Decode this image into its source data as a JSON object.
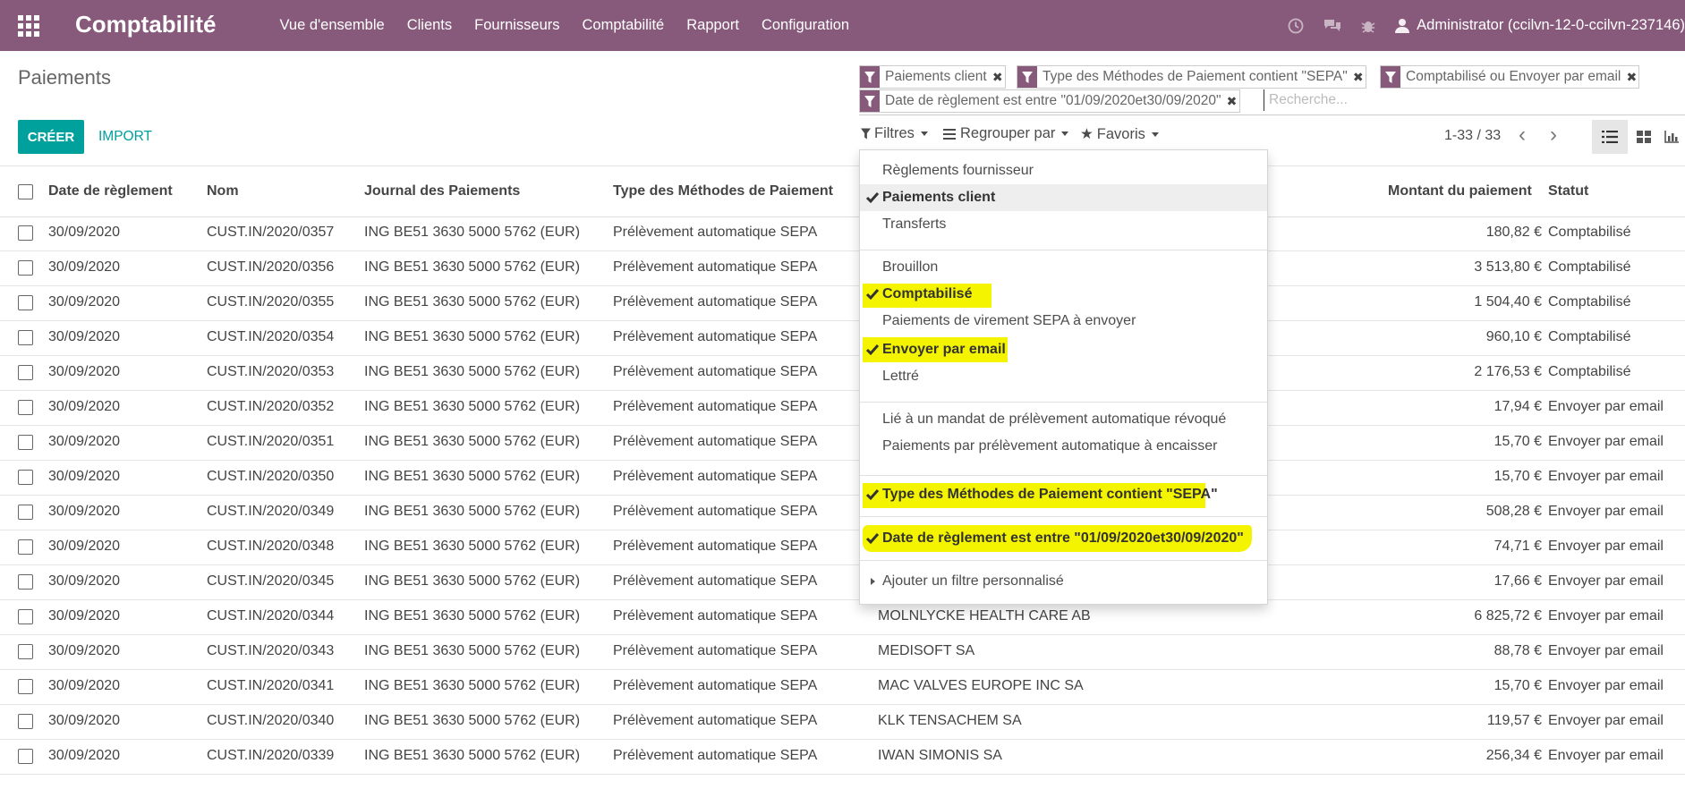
{
  "navbar": {
    "app_title": "Comptabilité",
    "menu": [
      "Vue d'ensemble",
      "Clients",
      "Fournisseurs",
      "Comptabilité",
      "Rapport",
      "Configuration"
    ],
    "user": "Administrator (ccilvn-12-0-ccilvn-237146)",
    "icons": [
      "apps-icon",
      "clock-icon",
      "chat-icon",
      "bug-icon",
      "user-icon"
    ],
    "color": "#875a7b"
  },
  "page": {
    "title": "Paiements",
    "create_label": "CRÉER",
    "import_label": "IMPORT",
    "accent": "#00a09d"
  },
  "search": {
    "facets": [
      "Paiements client",
      "Type des Méthodes de Paiement contient \"SEPA\"",
      "Comptabilisé ou Envoyer par email",
      "Date de règlement est entre \"01/09/2020et30/09/2020\""
    ],
    "placeholder": "Recherche...",
    "filters_label": "Filtres",
    "groupby_label": "Regrouper par",
    "favorites_label": "Favoris"
  },
  "pager": {
    "value": "1-33 / 33"
  },
  "filters_menu": {
    "items": [
      {
        "label": "Règlements fournisseur",
        "checked": false
      },
      {
        "label": "Paiements client",
        "checked": true
      },
      {
        "label": "Transferts",
        "checked": false
      },
      {
        "label": "Brouillon",
        "checked": false
      },
      {
        "label": "Comptabilisé",
        "checked": true
      },
      {
        "label": "Paiements de virement SEPA à envoyer",
        "checked": false
      },
      {
        "label": "Envoyer par email",
        "checked": true
      },
      {
        "label": "Lettré",
        "checked": false
      },
      {
        "label": "Lié à un mandat de prélèvement automatique révoqué",
        "checked": false
      },
      {
        "label": "Paiements par prélèvement automatique à encaisser",
        "checked": false
      },
      {
        "label": "Type des Méthodes de Paiement contient \"SEPA\"",
        "checked": true
      },
      {
        "label": "Date de règlement est entre \"01/09/2020et30/09/2020\"",
        "checked": true
      },
      {
        "label": "Ajouter un filtre personnalisé",
        "checked": false
      }
    ],
    "highlight_color": "#f4f400"
  },
  "table": {
    "columns": [
      "Date de règlement",
      "Nom",
      "Journal des Paiements",
      "Type des Méthodes de Paiement",
      "Montant du paiement",
      "Statut"
    ],
    "rows": [
      {
        "date": "30/09/2020",
        "name": "CUST.IN/2020/0357",
        "journal": "ING BE51 3630 5000 5762 (EUR)",
        "method": "Prélèvement automatique SEPA",
        "partner": "",
        "amount": "180,82 €",
        "status": "Comptabilisé"
      },
      {
        "date": "30/09/2020",
        "name": "CUST.IN/2020/0356",
        "journal": "ING BE51 3630 5000 5762 (EUR)",
        "method": "Prélèvement automatique SEPA",
        "partner": "",
        "amount": "3 513,80 €",
        "status": "Comptabilisé"
      },
      {
        "date": "30/09/2020",
        "name": "CUST.IN/2020/0355",
        "journal": "ING BE51 3630 5000 5762 (EUR)",
        "method": "Prélèvement automatique SEPA",
        "partner": "",
        "amount": "1 504,40 €",
        "status": "Comptabilisé"
      },
      {
        "date": "30/09/2020",
        "name": "CUST.IN/2020/0354",
        "journal": "ING BE51 3630 5000 5762 (EUR)",
        "method": "Prélèvement automatique SEPA",
        "partner": "",
        "amount": "960,10 €",
        "status": "Comptabilisé"
      },
      {
        "date": "30/09/2020",
        "name": "CUST.IN/2020/0353",
        "journal": "ING BE51 3630 5000 5762 (EUR)",
        "method": "Prélèvement automatique SEPA",
        "partner": "",
        "amount": "2 176,53 €",
        "status": "Comptabilisé"
      },
      {
        "date": "30/09/2020",
        "name": "CUST.IN/2020/0352",
        "journal": "ING BE51 3630 5000 5762 (EUR)",
        "method": "Prélèvement automatique SEPA",
        "partner": "",
        "amount": "17,94 €",
        "status": "Envoyer par email"
      },
      {
        "date": "30/09/2020",
        "name": "CUST.IN/2020/0351",
        "journal": "ING BE51 3630 5000 5762 (EUR)",
        "method": "Prélèvement automatique SEPA",
        "partner": "",
        "amount": "15,70 €",
        "status": "Envoyer par email"
      },
      {
        "date": "30/09/2020",
        "name": "CUST.IN/2020/0350",
        "journal": "ING BE51 3630 5000 5762 (EUR)",
        "method": "Prélèvement automatique SEPA",
        "partner": "",
        "amount": "15,70 €",
        "status": "Envoyer par email"
      },
      {
        "date": "30/09/2020",
        "name": "CUST.IN/2020/0349",
        "journal": "ING BE51 3630 5000 5762 (EUR)",
        "method": "Prélèvement automatique SEPA",
        "partner": "",
        "amount": "508,28 €",
        "status": "Envoyer par email"
      },
      {
        "date": "30/09/2020",
        "name": "CUST.IN/2020/0348",
        "journal": "ING BE51 3630 5000 5762 (EUR)",
        "method": "Prélèvement automatique SEPA",
        "partner": "",
        "amount": "74,71 €",
        "status": "Envoyer par email"
      },
      {
        "date": "30/09/2020",
        "name": "CUST.IN/2020/0345",
        "journal": "ING BE51 3630 5000 5762 (EUR)",
        "method": "Prélèvement automatique SEPA",
        "partner": "",
        "amount": "17,66 €",
        "status": "Envoyer par email"
      },
      {
        "date": "30/09/2020",
        "name": "CUST.IN/2020/0344",
        "journal": "ING BE51 3630 5000 5762 (EUR)",
        "method": "Prélèvement automatique SEPA",
        "partner": "MOLNLYCKE HEALTH CARE AB",
        "amount": "6 825,72 €",
        "status": "Envoyer par email"
      },
      {
        "date": "30/09/2020",
        "name": "CUST.IN/2020/0343",
        "journal": "ING BE51 3630 5000 5762 (EUR)",
        "method": "Prélèvement automatique SEPA",
        "partner": "MEDISOFT SA",
        "amount": "88,78 €",
        "status": "Envoyer par email"
      },
      {
        "date": "30/09/2020",
        "name": "CUST.IN/2020/0341",
        "journal": "ING BE51 3630 5000 5762 (EUR)",
        "method": "Prélèvement automatique SEPA",
        "partner": "MAC VALVES EUROPE INC SA",
        "amount": "15,70 €",
        "status": "Envoyer par email"
      },
      {
        "date": "30/09/2020",
        "name": "CUST.IN/2020/0340",
        "journal": "ING BE51 3630 5000 5762 (EUR)",
        "method": "Prélèvement automatique SEPA",
        "partner": "KLK TENSACHEM SA",
        "amount": "119,57 €",
        "status": "Envoyer par email"
      },
      {
        "date": "30/09/2020",
        "name": "CUST.IN/2020/0339",
        "journal": "ING BE51 3630 5000 5762 (EUR)",
        "method": "Prélèvement automatique SEPA",
        "partner": "IWAN SIMONIS SA",
        "amount": "256,34 €",
        "status": "Envoyer par email"
      }
    ]
  }
}
